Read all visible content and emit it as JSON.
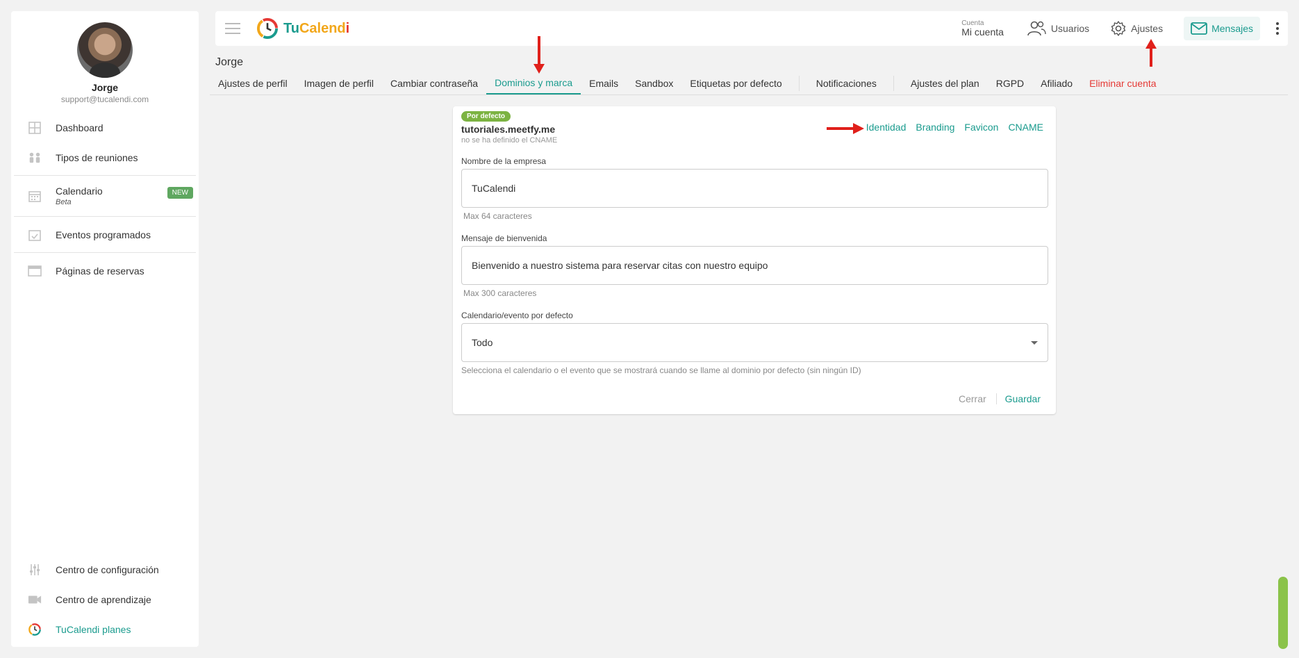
{
  "sidebar": {
    "profile": {
      "name": "Jorge",
      "email": "support@tucalendi.com"
    },
    "items": [
      {
        "label": "Dashboard",
        "icon": "dashboard-icon"
      },
      {
        "label": "Tipos de reuniones",
        "icon": "people-icon"
      },
      {
        "label": "Calendario",
        "sub": "Beta",
        "badge": "NEW",
        "icon": "calendar-icon"
      },
      {
        "label": "Eventos programados",
        "icon": "calendar-check-icon"
      },
      {
        "label": "Páginas de reservas",
        "icon": "browser-window-icon"
      }
    ],
    "bottom_items": [
      {
        "label": "Centro de configuración",
        "icon": "sliders-icon"
      },
      {
        "label": "Centro de aprendizaje",
        "icon": "video-camera-icon"
      },
      {
        "label": "TuCalendi planes",
        "icon": "tucalendi-logo-icon"
      }
    ]
  },
  "topbar": {
    "logo": {
      "tu": "Tu",
      "calend": "Calend",
      "i": "i"
    },
    "account_label": "Cuenta",
    "account_value": "Mi cuenta",
    "users": "Usuarios",
    "settings": "Ajustes",
    "messages": "Mensajes"
  },
  "page": {
    "user_title": "Jorge",
    "tabs": [
      "Ajustes de perfil",
      "Imagen de perfil",
      "Cambiar contraseña",
      "Dominios y marca",
      "Emails",
      "Sandbox",
      "Etiquetas por defecto",
      "Notificaciones",
      "Ajustes del plan",
      "RGPD",
      "Afiliado",
      "Eliminar cuenta"
    ],
    "active_tab": "Dominios y marca"
  },
  "card": {
    "badge": "Por defecto",
    "domain": "tutoriales.meetfy.me",
    "cname_note": "no se ha definido el CNAME",
    "links": [
      "Identidad",
      "Branding",
      "Favicon",
      "CNAME"
    ],
    "company_label": "Nombre de la empresa",
    "company_value": "TuCalendi",
    "company_hint": "Max 64 caracteres",
    "welcome_label": "Mensaje de bienvenida",
    "welcome_value": "Bienvenido a nuestro sistema para reservar citas con nuestro equipo",
    "welcome_hint": "Max 300 caracteres",
    "default_label": "Calendario/evento por defecto",
    "default_value": "Todo",
    "default_hint": "Selecciona el calendario o el evento que se mostrará cuando se llame al dominio por defecto (sin ningún ID)",
    "close": "Cerrar",
    "save": "Guardar"
  },
  "colors": {
    "accent": "#1a9b8e",
    "danger": "#e53935",
    "badge_green": "#7cb342",
    "annotation_red": "#e0201b"
  }
}
